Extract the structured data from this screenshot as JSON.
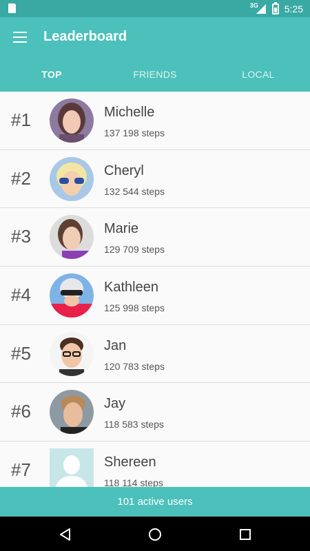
{
  "status_bar": {
    "network": "3G",
    "time": "5:25"
  },
  "app": {
    "title": "Leaderboard"
  },
  "tabs": [
    {
      "label": "TOP"
    },
    {
      "label": "FRIENDS"
    },
    {
      "label": "LOCAL"
    }
  ],
  "entries": [
    {
      "rank": "#1",
      "name": "Michelle",
      "steps": "137 198 steps"
    },
    {
      "rank": "#2",
      "name": "Cheryl",
      "steps": "132 544 steps"
    },
    {
      "rank": "#3",
      "name": "Marie",
      "steps": "129 709 steps"
    },
    {
      "rank": "#4",
      "name": "Kathleen",
      "steps": "125 998 steps"
    },
    {
      "rank": "#5",
      "name": "Jan",
      "steps": "120 783 steps"
    },
    {
      "rank": "#6",
      "name": "Jay",
      "steps": "118 583 steps"
    },
    {
      "rank": "#7",
      "name": "Shereen",
      "steps": "118 114 steps"
    }
  ],
  "footer": {
    "label": "101 active users"
  },
  "colors": {
    "accent": "#4cc0bb",
    "status_bar": "#3aa9a4"
  }
}
